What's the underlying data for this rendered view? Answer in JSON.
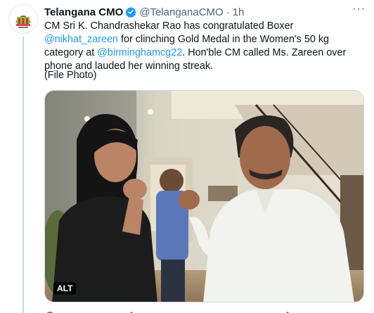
{
  "account": {
    "display_name": "Telangana CMO",
    "handle": "@TelanganaCMO",
    "separator": "·",
    "time": "1h",
    "more": "···"
  },
  "tweet": {
    "part1": "CM Sri K. Chandrashekar Rao has congratulated Boxer ",
    "mention1": "@nikhat_zareen",
    "part2": " for clinching Gold Medal in the Women's 50 kg category at ",
    "mention2": "@birminghamcg22",
    "part3": ". Hon'ble CM called Ms. Zareen over phone and lauded her winning streak.",
    "note": "(File Photo)"
  },
  "media": {
    "alt_badge": "ALT"
  },
  "colors": {
    "link": "#1d9bf0",
    "verified": "#1d9bf0",
    "muted": "#536471"
  }
}
